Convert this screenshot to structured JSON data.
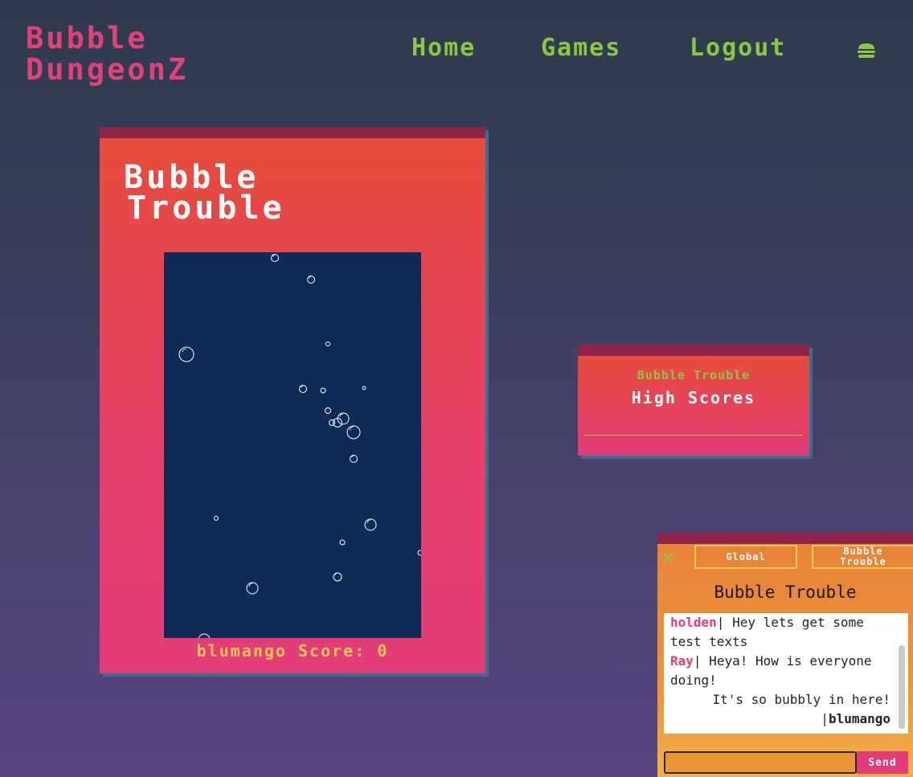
{
  "header": {
    "brand_line1": "Bubble",
    "brand_line2": "DungeonZ",
    "nav": {
      "home": "Home",
      "games": "Games",
      "logout": "Logout"
    },
    "menu_icon": "hamburger-icon"
  },
  "game": {
    "title_line1": "Bubble",
    "title_line2": "Trouble",
    "player": "blumango",
    "score_label": "Score:",
    "score": "0"
  },
  "high_scores": {
    "game_name": "Bubble Trouble",
    "title": "High Scores"
  },
  "chat": {
    "close_icon": "close-icon",
    "tabs": {
      "global": "Global",
      "room_line1": "Bubble",
      "room_line2": "Trouble"
    },
    "room_title": "Bubble Trouble",
    "messages": [
      {
        "user": "holden",
        "sep": "|",
        "text": " Hey lets get some test texts"
      },
      {
        "user": "Ray",
        "sep": "|",
        "text": " Heya! How is everyone doing!"
      }
    ],
    "self_message": {
      "text": "It's so bubbly in here!",
      "sep": "|",
      "user": "blumango"
    },
    "input_value": "",
    "send_label": "Send"
  },
  "colors": {
    "brand": "#e5407a",
    "nav": "#8dc63f",
    "card_top": "#8e2447",
    "canvas": "#0f2a57",
    "score": "#f2c94c",
    "chat_panel": "#ec9438"
  }
}
